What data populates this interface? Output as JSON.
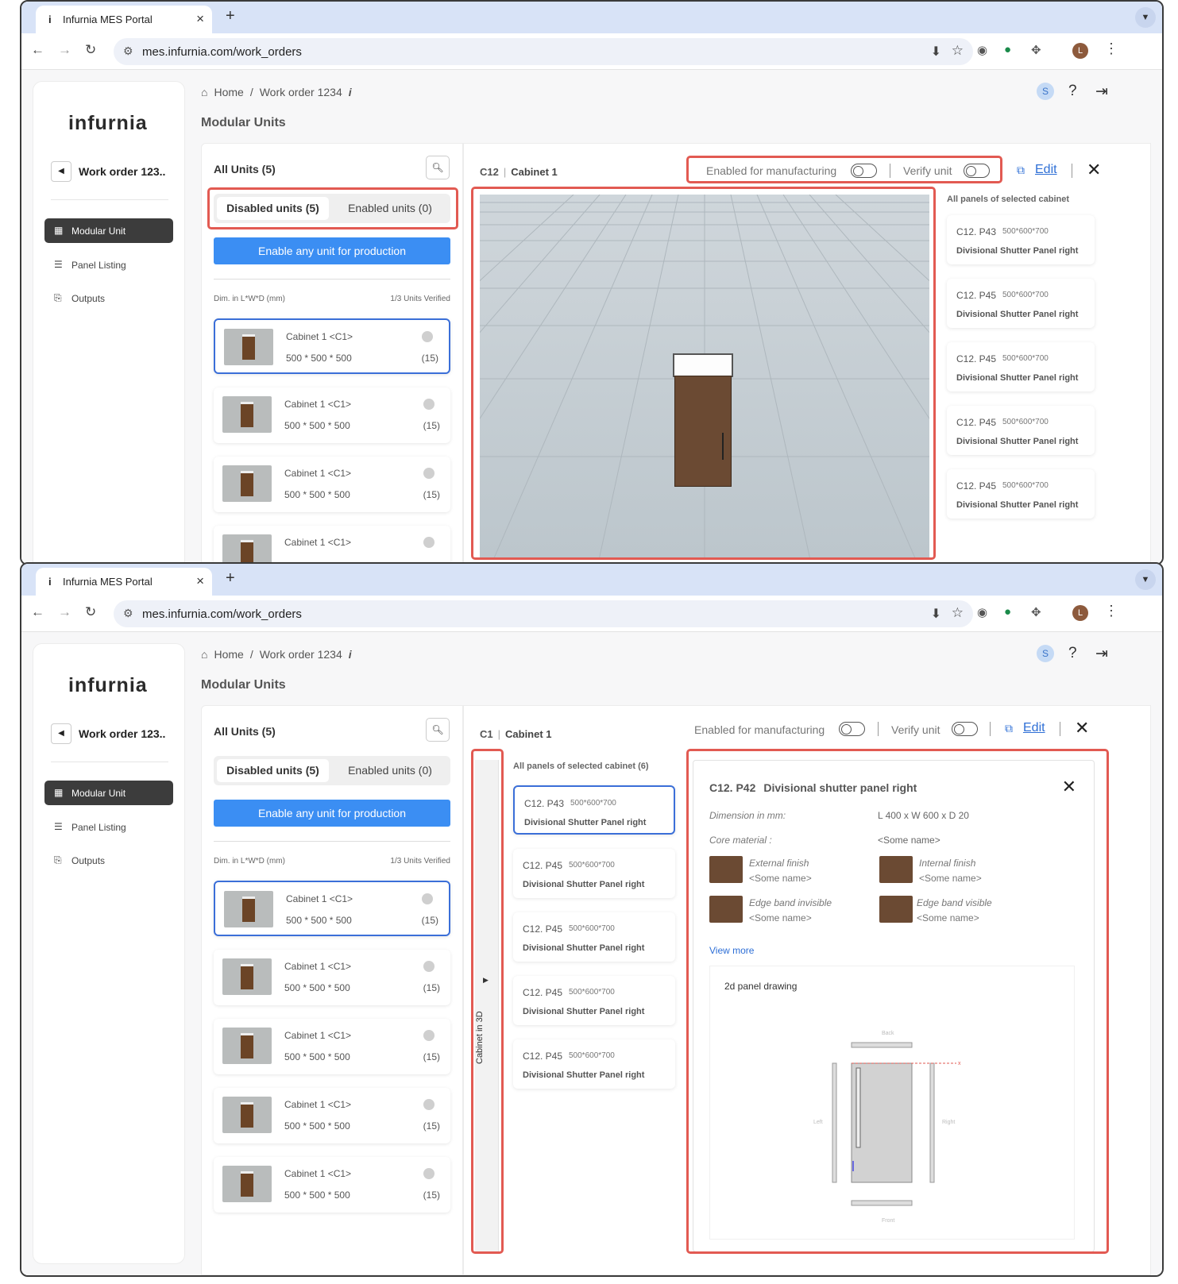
{
  "browser": {
    "tab_title": "Infurnia MES Portal",
    "tab_icon": "i",
    "url": "mes.infurnia.com/work_orders",
    "profile_initial": "L"
  },
  "app": {
    "logo": "infurnia",
    "work_order_name": "Work order 123..",
    "nav": [
      {
        "label": "Modular Unit",
        "icon": "grid-icon",
        "active": true
      },
      {
        "label": "Panel Listing",
        "icon": "list-icon",
        "active": false
      },
      {
        "label": "Outputs",
        "icon": "export-icon",
        "active": false
      }
    ],
    "breadcrumb": {
      "home": "Home",
      "separator": "/",
      "work_order": "Work order 1234"
    },
    "page_title": "Modular Units",
    "user_initial": "S"
  },
  "units_panel": {
    "title": "All Units (5)",
    "tab_disabled": "Disabled units (5)",
    "tab_enabled": "Enabled units (0)",
    "enable_button": "Enable any unit for production",
    "dim_label": "Dim. in L*W*D (mm)",
    "verified_label": "1/3 Units Verified",
    "units": [
      {
        "name": "Cabinet 1 <C1>",
        "dims": "500 * 500 * 500",
        "count": "(15)"
      },
      {
        "name": "Cabinet 1 <C1>",
        "dims": "500 * 500 * 500",
        "count": "(15)"
      },
      {
        "name": "Cabinet 1 <C1>",
        "dims": "500 * 500 * 500",
        "count": "(15)"
      },
      {
        "name": "Cabinet 1 <C1>",
        "dims": "500 * 500 * 500",
        "count": "(15)"
      },
      {
        "name": "Cabinet 1 <C1>",
        "dims": "500 * 500 * 500",
        "count": "(15)"
      }
    ]
  },
  "detail_top": {
    "code": "C12",
    "name": "Cabinet 1",
    "enabled_label": "Enabled for manufacturing",
    "verify_label": "Verify unit",
    "edit_label": "Edit",
    "panels_label": "All panels of selected cabinet",
    "panels": [
      {
        "code": "C12. P43",
        "dims": "500*600*700",
        "type": "Divisional Shutter Panel right"
      },
      {
        "code": "C12. P45",
        "dims": "500*600*700",
        "type": "Divisional Shutter Panel right"
      },
      {
        "code": "C12. P45",
        "dims": "500*600*700",
        "type": "Divisional Shutter Panel right"
      },
      {
        "code": "C12. P45",
        "dims": "500*600*700",
        "type": "Divisional Shutter Panel right"
      },
      {
        "code": "C12. P45",
        "dims": "500*600*700",
        "type": "Divisional Shutter Panel right"
      }
    ]
  },
  "detail_bottom": {
    "code": "C1",
    "name": "Cabinet 1",
    "enabled_label": "Enabled for manufacturing",
    "verify_label": "Verify unit",
    "edit_label": "Edit",
    "cabinet_3d_tab": "Cabinet in 3D",
    "panels_label": "All panels of selected cabinet  (6)",
    "panels": [
      {
        "code": "C12. P43",
        "dims": "500*600*700",
        "type": "Divisional Shutter Panel right"
      },
      {
        "code": "C12. P45",
        "dims": "500*600*700",
        "type": "Divisional Shutter Panel right"
      },
      {
        "code": "C12. P45",
        "dims": "500*600*700",
        "type": "Divisional Shutter Panel right"
      },
      {
        "code": "C12. P45",
        "dims": "500*600*700",
        "type": "Divisional Shutter Panel right"
      },
      {
        "code": "C12. P45",
        "dims": "500*600*700",
        "type": "Divisional Shutter Panel right"
      }
    ],
    "panel_detail": {
      "code": "C12. P42",
      "name": "Divisional shutter panel right",
      "dimension_label": "Dimension in mm:",
      "dimension_value": "L 400 x W 600 x D 20",
      "core_label": "Core material :",
      "core_value": "<Some name>",
      "materials": [
        {
          "label": "External finish",
          "value": "<Some name>"
        },
        {
          "label": "Internal finish",
          "value": "<Some name>"
        },
        {
          "label": "Edge band invisible",
          "value": "<Some name>"
        },
        {
          "label": "Edge band visible",
          "value": "<Some name>"
        }
      ],
      "view_more": "View more",
      "drawing_title": "2d panel drawing",
      "drawing_labels": {
        "back": "Back",
        "front": "Front",
        "left": "Left",
        "right": "Right"
      }
    }
  },
  "colors": {
    "accent": "#3b8ef3",
    "highlight": "#e25a52",
    "wood": "#6b4a33"
  }
}
